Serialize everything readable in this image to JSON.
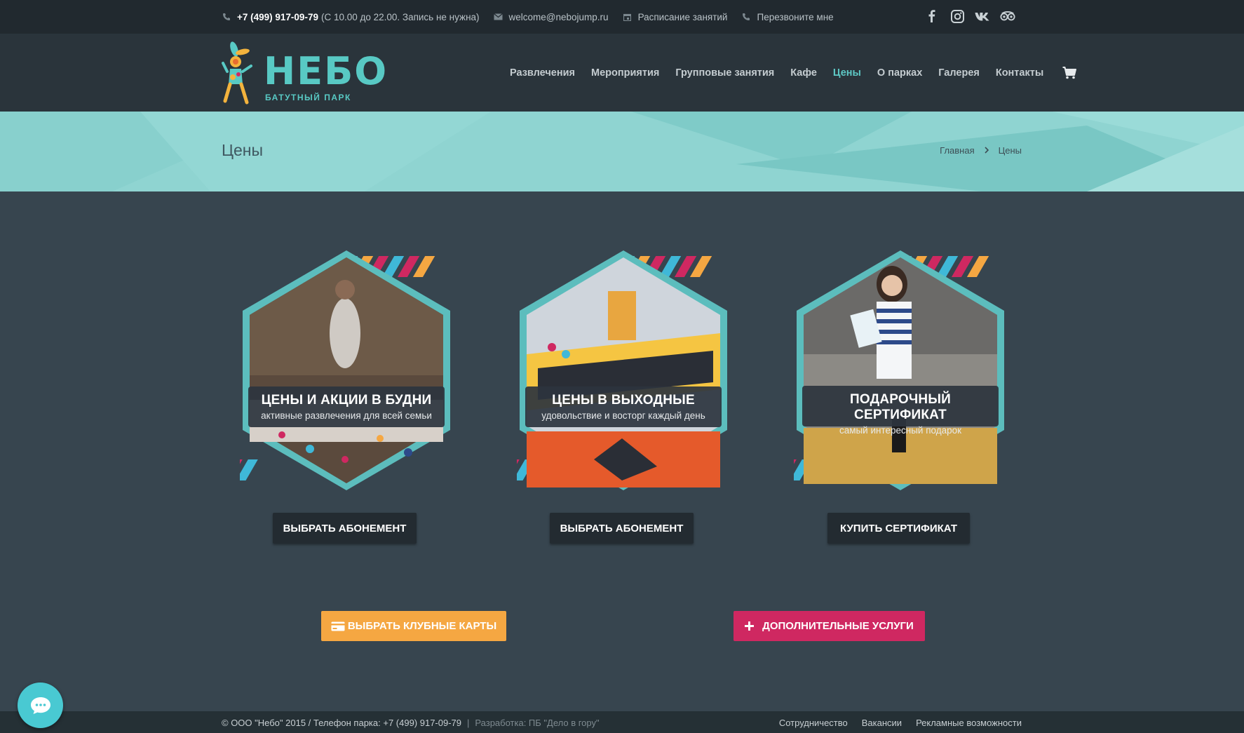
{
  "topbar": {
    "phone": "+7 (499) 917-09-79",
    "phone_note": "(С 10.00 до 22.00. Запись не нужна)",
    "email": "welcome@nebojump.ru",
    "schedule": "Расписание занятий",
    "callback": "Перезвоните мне"
  },
  "logo": {
    "title": "НЕБО",
    "subtitle": "БАТУТНЫЙ ПАРК"
  },
  "nav": {
    "items": [
      "Развлечения",
      "Мероприятия",
      "Групповые занятия",
      "Кафе",
      "Цены",
      "О парках",
      "Галерея",
      "Контакты"
    ],
    "active": "Цены"
  },
  "banner": {
    "title": "Цены"
  },
  "breadcrumb": {
    "home": "Главная",
    "current": "Цены"
  },
  "cards": [
    {
      "title": "ЦЕНЫ И АКЦИИ В БУДНИ",
      "subtitle": "активные развлечения для всей семьи",
      "button": "ВЫБРАТЬ АБОНЕМЕНТ"
    },
    {
      "title": "ЦЕНЫ В ВЫХОДНЫЕ",
      "subtitle": "удовольствие и восторг каждый день",
      "button": "ВЫБРАТЬ АБОНЕМЕНТ"
    },
    {
      "title": "ПОДАРОЧНЫЙ СЕРТИФИКАТ",
      "subtitle": "самый интересный подарок",
      "button": "КУПИТЬ СЕРТИФИКАТ"
    }
  ],
  "actions": {
    "club_cards": "ВЫБРАТЬ КЛУБНЫЕ КАРТЫ",
    "extra_services": "ДОПОЛНИТЕЛЬНЫЕ УСЛУГИ"
  },
  "footer": {
    "copyright": "© ООО \"Небо\" 2015 / Телефон парка: +7 (499) 917-09-79",
    "separator": "|",
    "developer": "Разработка: ПБ \"Дело в гору\"",
    "links": [
      "Сотрудничество",
      "Вакансии",
      "Рекламные возможности"
    ]
  },
  "colors": {
    "accent": "#5ec8c5",
    "orange": "#f5a742",
    "pink": "#cf2861",
    "background": "#37454f"
  }
}
